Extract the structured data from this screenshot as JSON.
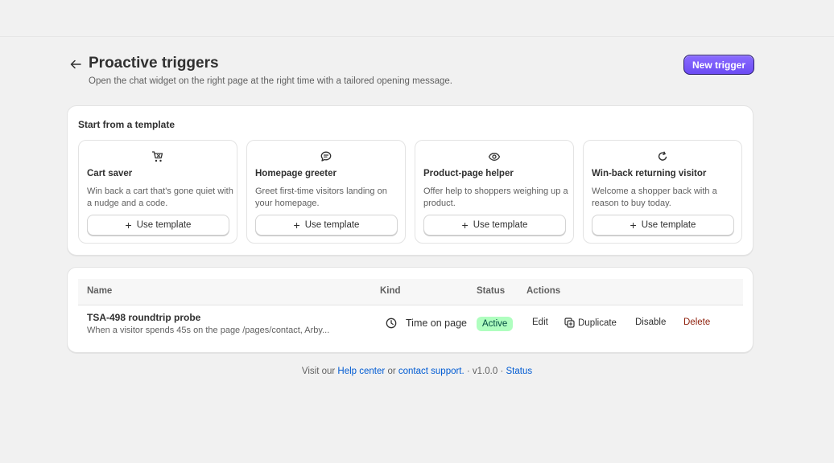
{
  "header": {
    "title": "Proactive triggers",
    "subtitle": "Open the chat widget on the right page at the right time with a tailored opening message.",
    "new_trigger_label": "New trigger"
  },
  "templates": {
    "heading": "Start from a template",
    "use_label": "Use template",
    "items": [
      {
        "name": "Cart saver",
        "description": "Win back a cart that's gone quiet with a nudge and a code.",
        "icon": "cart-icon"
      },
      {
        "name": "Homepage greeter",
        "description": "Greet first-time visitors landing on your homepage.",
        "icon": "chat-bubble-icon"
      },
      {
        "name": "Product-page helper",
        "description": "Offer help to shoppers weighing up a product.",
        "icon": "eye-icon"
      },
      {
        "name": "Win-back returning visitor",
        "description": "Welcome a shopper back with a reason to buy today.",
        "icon": "refresh-icon"
      }
    ]
  },
  "table": {
    "columns": {
      "name": "Name",
      "kind": "Kind",
      "status": "Status",
      "actions": "Actions"
    },
    "rows": [
      {
        "name": "TSA-498 roundtrip probe",
        "description": "When a visitor spends 45s on the page /pages/contact, Arby...",
        "kind": "Time on page",
        "kind_icon": "clock-icon",
        "status": "Active",
        "actions": {
          "edit": "Edit",
          "duplicate": "Duplicate",
          "disable": "Disable",
          "delete": "Delete"
        }
      }
    ]
  },
  "footer": {
    "prefix": "Visit our",
    "help_center": "Help center",
    "or": "or",
    "contact_support": "contact support.",
    "version": "· v1.0.0 ·",
    "status": "Status"
  },
  "colors": {
    "accent": "#6c4bf4",
    "link": "#005bd3",
    "active_badge": "#affebf",
    "danger": "#8e1f0b"
  }
}
